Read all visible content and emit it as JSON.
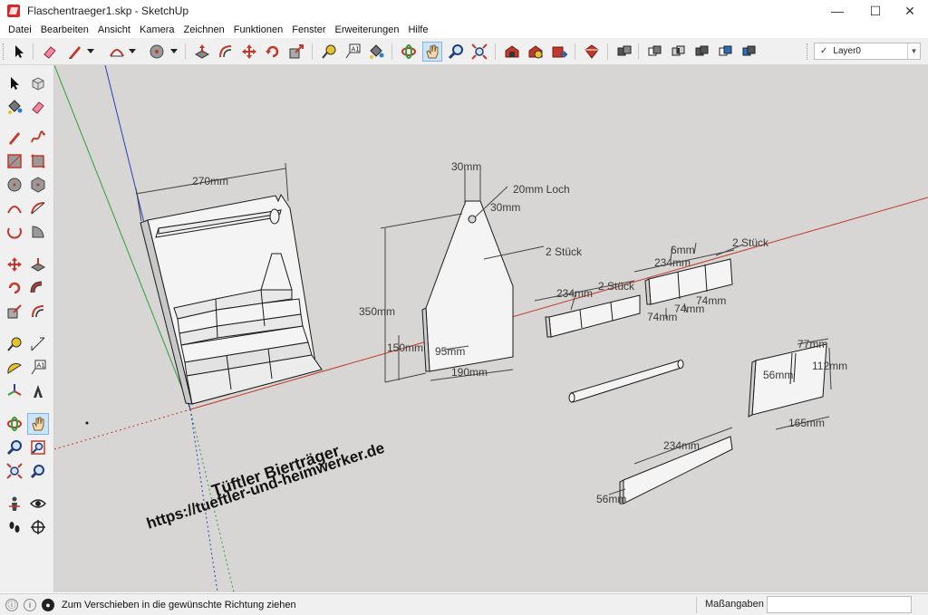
{
  "window": {
    "title": "Flaschentraeger1.skp - SketchUp",
    "minimize": "—",
    "maximize": "☐",
    "close": "✕"
  },
  "menubar": [
    {
      "label": "Datei"
    },
    {
      "label": "Bearbeiten"
    },
    {
      "label": "Ansicht"
    },
    {
      "label": "Kamera"
    },
    {
      "label": "Zeichnen"
    },
    {
      "label": "Funktionen"
    },
    {
      "label": "Fenster"
    },
    {
      "label": "Erweiterungen"
    },
    {
      "label": "Hilfe"
    }
  ],
  "layers": {
    "current": "Layer0",
    "check": "✓"
  },
  "model": {
    "dimensions": {
      "d270": "270mm",
      "d30a": "30mm",
      "loch": "20mm Loch",
      "d30b": "30mm",
      "stueck1": "2 Stück",
      "d350": "350mm",
      "d150": "150mm",
      "d95": "95mm",
      "d190": "190mm",
      "d234a": "234mm",
      "stueck2": "2 Stück",
      "d6": "6mm",
      "d234b": "234mm",
      "stueck3": "2 Stück",
      "d74a": "74mm",
      "d74b": "74mm",
      "d74c": "74mm",
      "d77": "77mm",
      "d56a": "56mm",
      "d112": "112mm",
      "d165": "165mm",
      "d234c": "234mm",
      "d56b": "56mm"
    },
    "watermark": {
      "line1": "Tüftler Bierträger",
      "line2": "https://tueftler-und-heimwerker.de"
    },
    "axis_colors": {
      "red": "#c0392b",
      "green": "#2e9e3a",
      "blue": "#2a3fb8"
    }
  },
  "statusbar": {
    "message": "Zum Verschieben in die gewünschte Richtung ziehen",
    "vcb_label": "Maßangaben",
    "vcb_value": ""
  },
  "colors": {
    "viewport_bg": "#d7d6d4",
    "face": "#f4f4f4",
    "edge": "#1a1a1a",
    "toolbar_bg": "#f0f0f0",
    "active_tool": "#cde4f7"
  }
}
